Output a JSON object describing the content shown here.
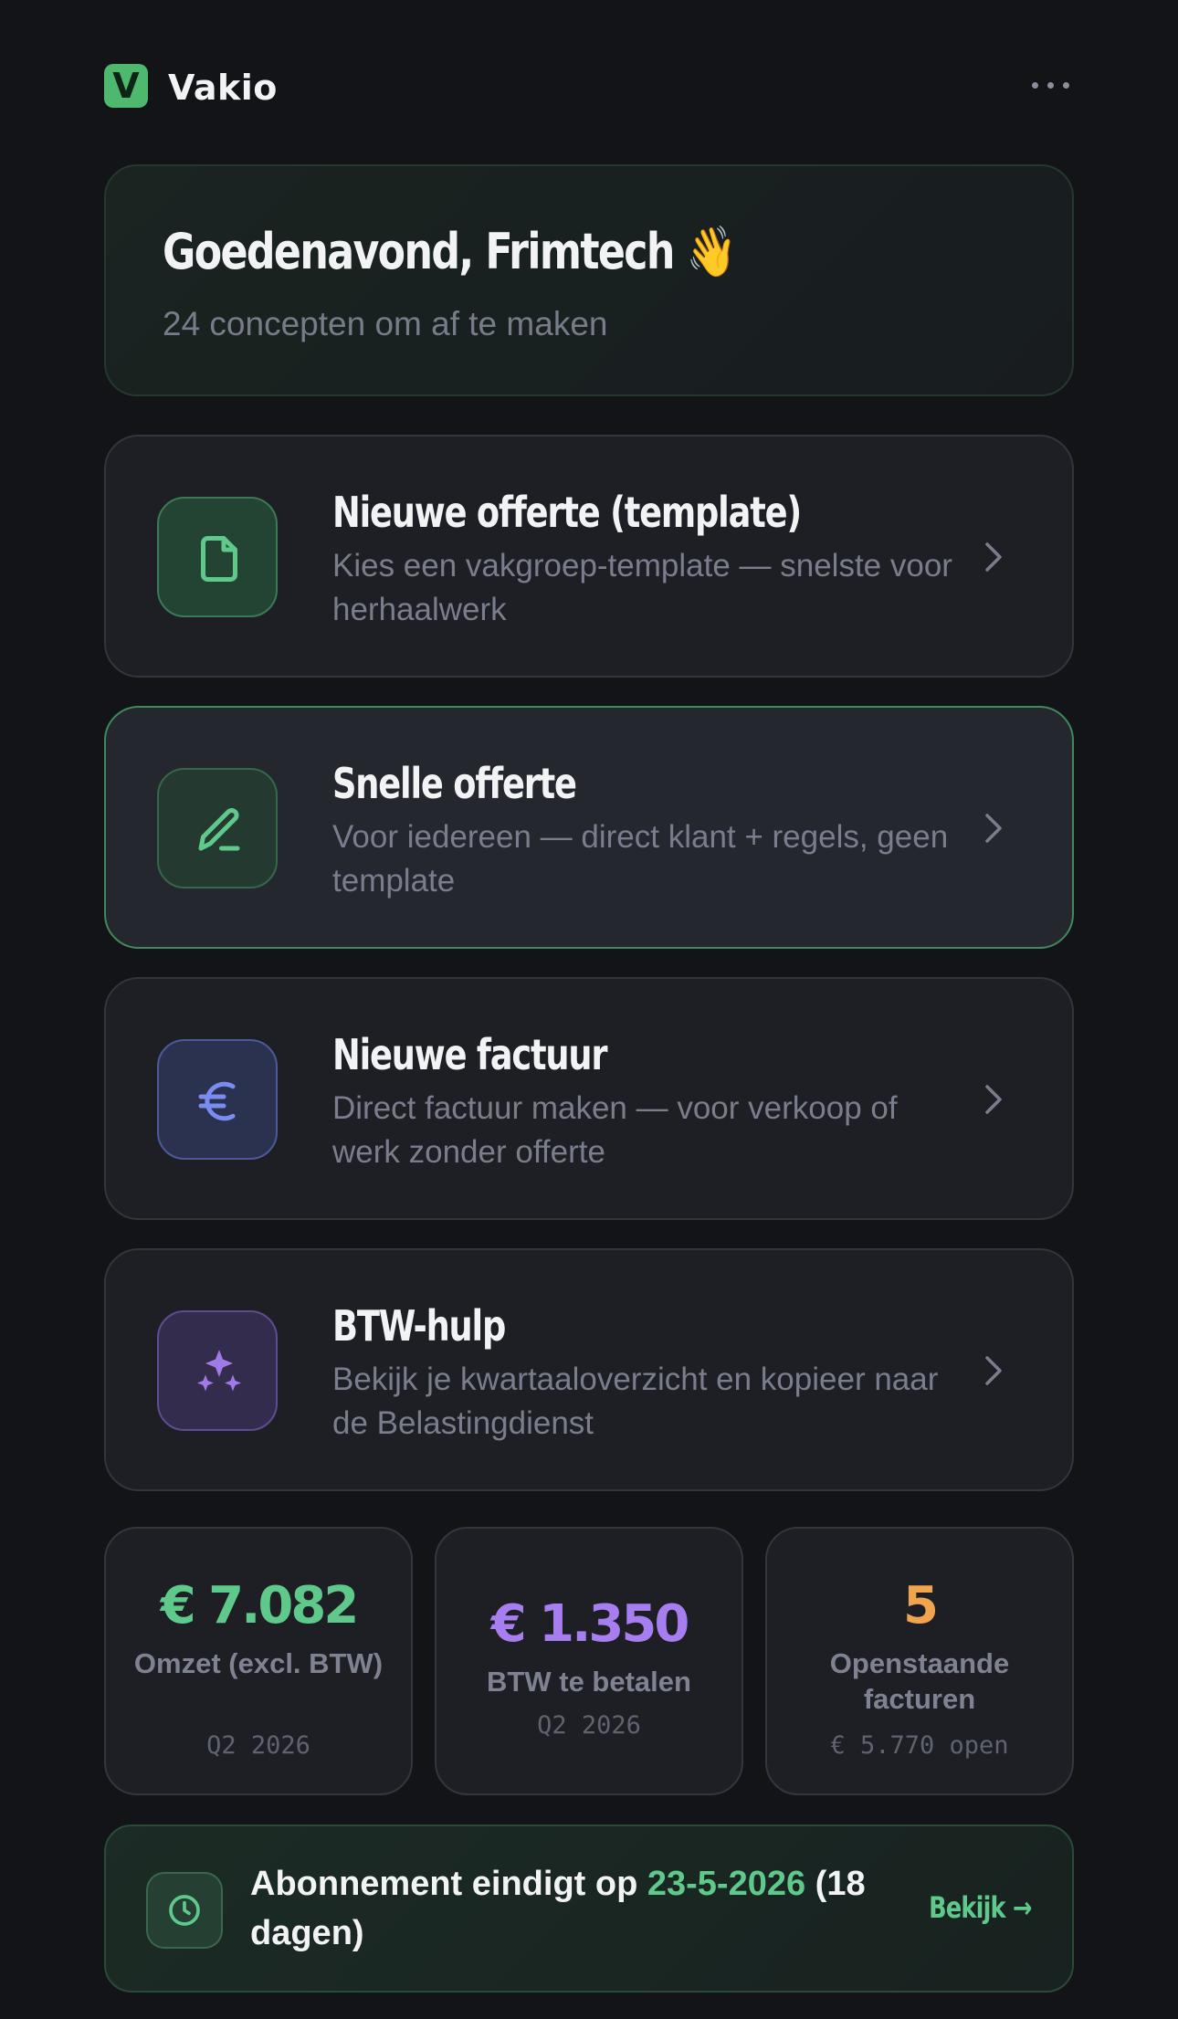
{
  "app": {
    "logo_letter": "V",
    "name": "Vakio"
  },
  "hero": {
    "title": "Goedenavond, Frimtech 👋",
    "subtitle": "24 concepten om af te maken"
  },
  "actions": [
    {
      "title": "Nieuwe offerte (template)",
      "description": "Kies een vakgroep-template — snelste voor herhaalwerk",
      "icon": "document-icon",
      "color": "#5ec98a"
    },
    {
      "title": "Snelle offerte",
      "description": "Voor iedereen — direct klant + regels, geen template",
      "icon": "pencil-icon",
      "color": "#5ec98a"
    },
    {
      "title": "Nieuwe factuur",
      "description": "Direct factuur maken — voor verkoop of werk zonder offerte",
      "icon": "euro-icon",
      "color": "#7b8cf0"
    },
    {
      "title": "BTW-hulp",
      "description": "Bekijk je kwartaaloverzicht en kopieer naar de Belastingdienst",
      "icon": "sparkles-icon",
      "color": "#a07be8"
    }
  ],
  "stats": [
    {
      "value": "€ 7.082",
      "label": "Omzet (excl. BTW)",
      "sub": "Q2 2026",
      "color": "#5ec98a"
    },
    {
      "value": "€ 1.350",
      "label": "BTW te betalen",
      "sub": "Q2 2026",
      "color": "#a67ef0"
    },
    {
      "value": "5",
      "label": "Openstaande facturen",
      "sub": "€ 5.770 open",
      "color": "#f0a44e"
    }
  ],
  "subscription": {
    "prefix": "Abonnement eindigt op ",
    "date": "23-5-2026",
    "suffix": " (18 dagen)",
    "link_label": "Bekijk →"
  }
}
